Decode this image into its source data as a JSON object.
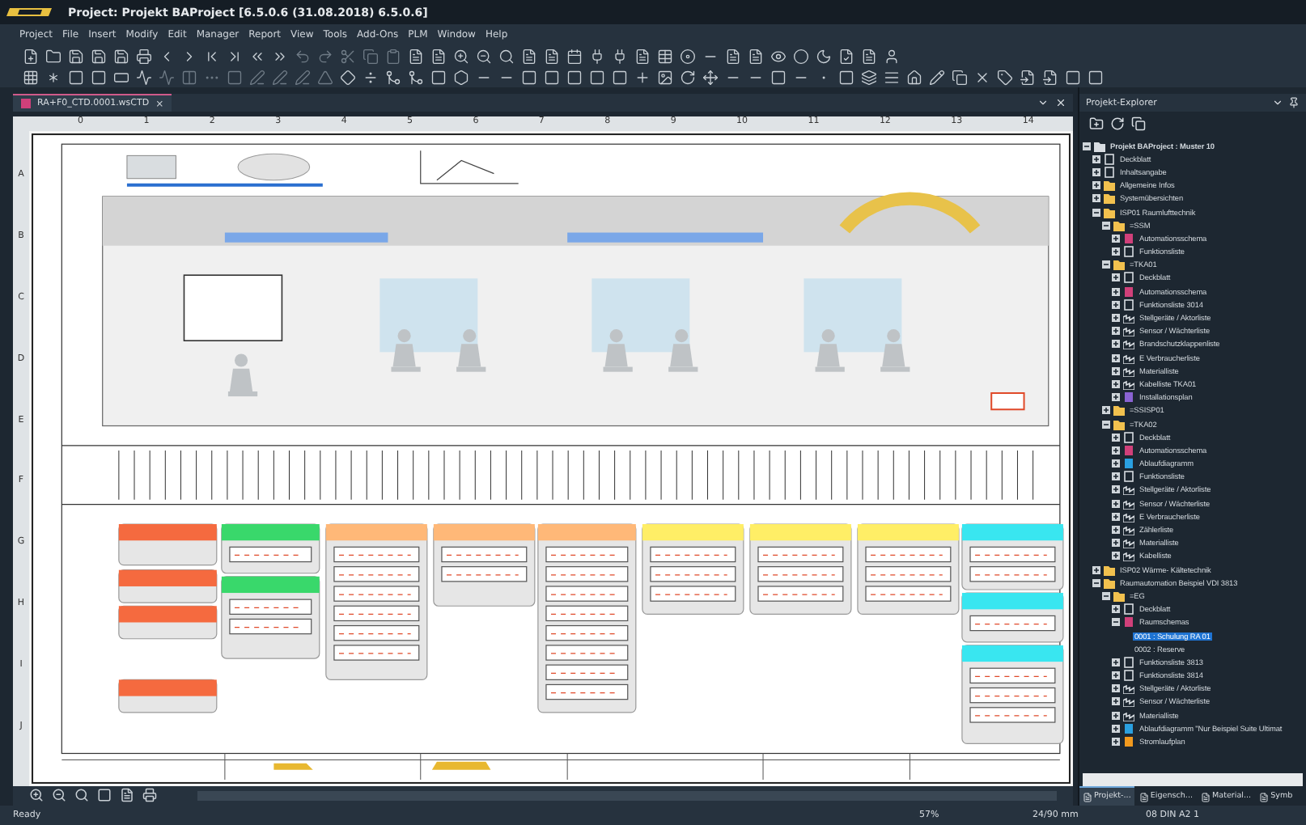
{
  "window": {
    "title": "Project: Projekt BAProject [6.5.0.6 (31.08.2018) 6.5.0.6]"
  },
  "menu": [
    "Project",
    "File",
    "Insert",
    "Modify",
    "Edit",
    "Manager",
    "Report",
    "View",
    "Tools",
    "Add-Ons",
    "PLM",
    "Window",
    "Help"
  ],
  "document_tab": {
    "label": "RA+F0_CTD.0001.wsCTD",
    "close": "×"
  },
  "ruler": {
    "columns": [
      "0",
      "1",
      "2",
      "3",
      "4",
      "5",
      "6",
      "7",
      "8",
      "9",
      "10",
      "11",
      "12",
      "13",
      "14"
    ],
    "rows": [
      "A",
      "B",
      "C",
      "D",
      "E",
      "F",
      "G",
      "H",
      "I",
      "J"
    ]
  },
  "explorer": {
    "title": "Projekt-Explorer",
    "tree": [
      {
        "label": "Projekt BAProject : Muster 10",
        "kind": "project",
        "expanded": true,
        "selected": false,
        "children": [
          {
            "label": "Deckblatt",
            "kind": "page",
            "expanded": false,
            "selected": false
          },
          {
            "label": "Inhaltsangabe",
            "kind": "list",
            "expanded": false,
            "selected": false
          },
          {
            "label": "Allgemeine Infos",
            "kind": "folder",
            "expanded": false,
            "selected": false
          },
          {
            "label": "Systemübersichten",
            "kind": "folder",
            "expanded": false,
            "selected": false
          },
          {
            "label": "ISP01 Raumlufttechnik",
            "kind": "folder",
            "expanded": true,
            "selected": false,
            "children": [
              {
                "label": "=SSM",
                "kind": "folder",
                "expanded": true,
                "selected": false,
                "children": [
                  {
                    "label": "Automationsschema",
                    "kind": "schema",
                    "expanded": false,
                    "selected": false
                  },
                  {
                    "label": "Funktionsliste",
                    "kind": "list",
                    "expanded": false,
                    "selected": false
                  }
                ]
              },
              {
                "label": "=TKA01",
                "kind": "folder",
                "expanded": true,
                "selected": false,
                "children": [
                  {
                    "label": "Deckblatt",
                    "kind": "page",
                    "expanded": false,
                    "selected": false
                  },
                  {
                    "label": "Automationsschema",
                    "kind": "schema",
                    "expanded": false,
                    "selected": false
                  },
                  {
                    "label": "Funktionsliste 3014",
                    "kind": "list",
                    "expanded": false,
                    "selected": false
                  },
                  {
                    "label": "Stellgeräte / Aktorliste",
                    "kind": "device",
                    "expanded": false,
                    "selected": false
                  },
                  {
                    "label": "Sensor / Wächterliste",
                    "kind": "device",
                    "expanded": false,
                    "selected": false
                  },
                  {
                    "label": "Brandschutzklappenliste",
                    "kind": "device",
                    "expanded": false,
                    "selected": false
                  },
                  {
                    "label": "E Verbraucherliste",
                    "kind": "device",
                    "expanded": false,
                    "selected": false
                  },
                  {
                    "label": "Materialliste",
                    "kind": "device",
                    "expanded": false,
                    "selected": false
                  },
                  {
                    "label": "Kabelliste TKA01",
                    "kind": "cable",
                    "expanded": false,
                    "selected": false
                  },
                  {
                    "label": "Installationsplan",
                    "kind": "plan",
                    "expanded": false,
                    "selected": false
                  }
                ]
              },
              {
                "label": "=SSISP01",
                "kind": "folder",
                "expanded": false,
                "selected": false
              },
              {
                "label": "=TKA02",
                "kind": "folder",
                "expanded": true,
                "selected": false,
                "children": [
                  {
                    "label": "Deckblatt",
                    "kind": "page",
                    "expanded": false,
                    "selected": false
                  },
                  {
                    "label": "Automationsschema",
                    "kind": "schema",
                    "expanded": false,
                    "selected": false
                  },
                  {
                    "label": "Ablaufdiagramm",
                    "kind": "flow",
                    "expanded": false,
                    "selected": false
                  },
                  {
                    "label": "Funktionsliste",
                    "kind": "list",
                    "expanded": false,
                    "selected": false
                  },
                  {
                    "label": "Stellgeräte / Aktorliste",
                    "kind": "device",
                    "expanded": false,
                    "selected": false
                  },
                  {
                    "label": "Sensor / Wächterliste",
                    "kind": "device",
                    "expanded": false,
                    "selected": false
                  },
                  {
                    "label": "E Verbraucherliste",
                    "kind": "device",
                    "expanded": false,
                    "selected": false
                  },
                  {
                    "label": "Zählerliste",
                    "kind": "device",
                    "expanded": false,
                    "selected": false
                  },
                  {
                    "label": "Materialliste",
                    "kind": "device",
                    "expanded": false,
                    "selected": false
                  },
                  {
                    "label": "Kabelliste",
                    "kind": "cable",
                    "expanded": false,
                    "selected": false
                  }
                ]
              }
            ]
          },
          {
            "label": "ISP02 Wärme- Kältetechnik",
            "kind": "folder",
            "expanded": false,
            "selected": false
          },
          {
            "label": "Raumautomation Beispiel VDI 3813",
            "kind": "folder",
            "expanded": true,
            "selected": false,
            "children": [
              {
                "label": "=EG",
                "kind": "folder",
                "expanded": true,
                "selected": false,
                "children": [
                  {
                    "label": "Deckblatt",
                    "kind": "page",
                    "expanded": false,
                    "selected": false
                  },
                  {
                    "label": "Raumschemas",
                    "kind": "schema",
                    "expanded": true,
                    "selected": false,
                    "children": [
                      {
                        "label": "0001 : Schulung RA 01",
                        "kind": "sheet",
                        "selected": true
                      },
                      {
                        "label": "0002 : Reserve",
                        "kind": "sheet",
                        "selected": false
                      }
                    ]
                  },
                  {
                    "label": "Funktionsliste 3813",
                    "kind": "list",
                    "expanded": false,
                    "selected": false
                  },
                  {
                    "label": "Funktionsliste 3814",
                    "kind": "list",
                    "expanded": false,
                    "selected": false
                  },
                  {
                    "label": "Stellgeräte / Aktorliste",
                    "kind": "device",
                    "expanded": false,
                    "selected": false
                  },
                  {
                    "label": "Sensor / Wächterliste",
                    "kind": "device",
                    "expanded": false,
                    "selected": false
                  },
                  {
                    "label": "Materialliste",
                    "kind": "device",
                    "expanded": false,
                    "selected": false
                  },
                  {
                    "label": "Ablaufdiagramm \"Nur Beispiel Suite Ultimat",
                    "kind": "flow",
                    "expanded": false,
                    "selected": false
                  },
                  {
                    "label": "Stromlaufplan",
                    "kind": "power",
                    "expanded": false,
                    "selected": false
                  }
                ]
              }
            ]
          }
        ]
      }
    ]
  },
  "panel_tabs": [
    {
      "label": "Projekt-...",
      "selected": true
    },
    {
      "label": "Eigensch...",
      "selected": false
    },
    {
      "label": "Material...",
      "selected": false
    },
    {
      "label": "Symb",
      "selected": false
    }
  ],
  "status_bar": [
    "Ready",
    "57%",
    "24/90 mm",
    "08  DIN A2  1"
  ]
}
